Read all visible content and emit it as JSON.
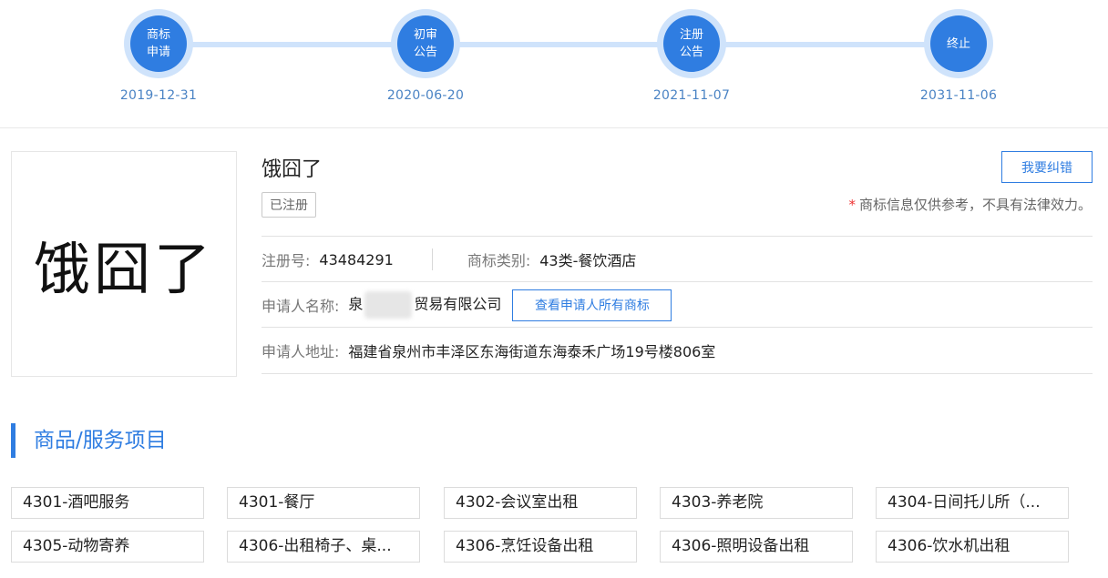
{
  "timeline": {
    "steps": [
      {
        "line1": "商标",
        "line2": "申请",
        "date": "2019-12-31"
      },
      {
        "line1": "初审",
        "line2": "公告",
        "date": "2020-06-20"
      },
      {
        "line1": "注册",
        "line2": "公告",
        "date": "2021-11-07"
      },
      {
        "line1": "终止",
        "line2": "",
        "date": "2031-11-06"
      }
    ]
  },
  "trademark": {
    "logo_text": "饿囧了",
    "name": "饿囧了",
    "status": "已注册",
    "correct_label": "我要纠错",
    "disclaimer_star": "*",
    "disclaimer": "商标信息仅供参考，不具有法律效力。"
  },
  "info": {
    "reg_no_label": "注册号:",
    "reg_no": "43484291",
    "class_label": "商标类别:",
    "class_value": "43类-餐饮酒店",
    "applicant_label": "申请人名称:",
    "applicant_prefix": "泉",
    "applicant_suffix": "贸易有限公司",
    "view_all_label": "查看申请人所有商标",
    "address_label": "申请人地址:",
    "address": "福建省泉州市丰泽区东海街道东海泰禾广场19号楼806室"
  },
  "services": {
    "title": "商品/服务项目",
    "items": [
      "4301-酒吧服务",
      "4301-餐厅",
      "4302-会议室出租",
      "4303-养老院",
      "4304-日间托儿所（...",
      "4305-动物寄养",
      "4306-出租椅子、桌...",
      "4306-烹饪设备出租",
      "4306-照明设备出租",
      "4306-饮水机出租"
    ]
  }
}
